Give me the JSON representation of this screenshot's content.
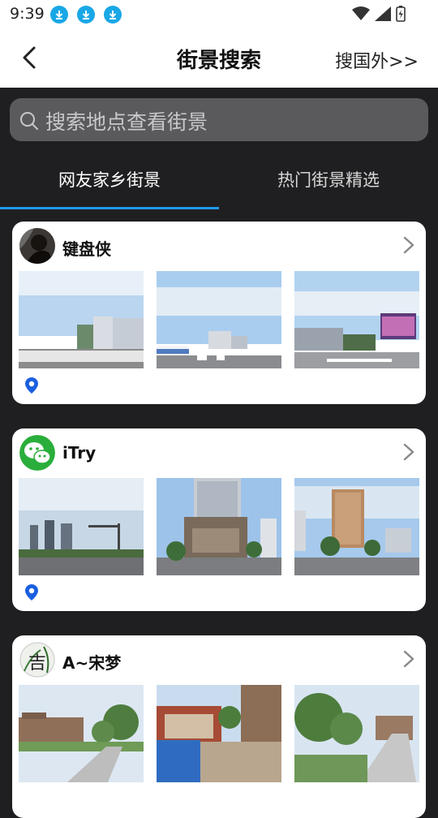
{
  "status": {
    "time": "9:39"
  },
  "nav": {
    "title": "街景搜索",
    "abroad_link": "搜国外>>"
  },
  "search": {
    "placeholder": "搜索地点查看街景"
  },
  "tabs": [
    {
      "label": "网友家乡街景"
    },
    {
      "label": "热门街景精选"
    }
  ],
  "colors": {
    "accent": "#1e9bea",
    "background": "#1f1f21",
    "card": "#ffffff",
    "pin": "#1a5fe0"
  },
  "cards": [
    {
      "user": "键盘侠"
    },
    {
      "user": "iTry"
    },
    {
      "user": "A~宋梦",
      "avatar_text": "吉"
    }
  ]
}
